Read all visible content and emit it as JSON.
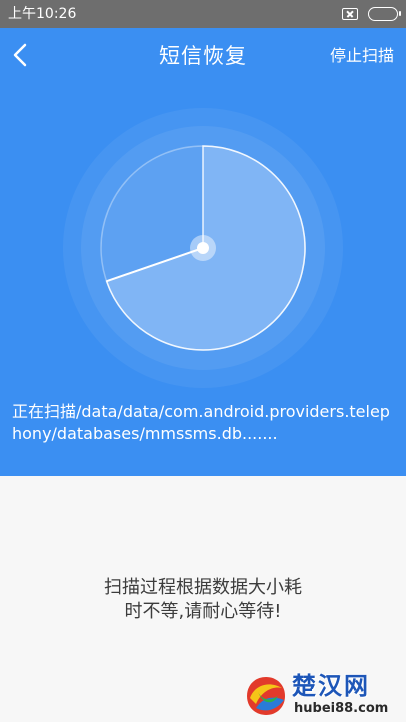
{
  "status_bar": {
    "time": "上午10:26"
  },
  "header": {
    "title": "短信恢复",
    "stop_label": "停止扫描"
  },
  "scan": {
    "path_text": "正在扫描/data/data/com.android.providers.telephony/databases/mmssms.db......."
  },
  "message": {
    "line1": "扫描过程根据数据大小耗",
    "line2": "时不等,请耐心等待!"
  },
  "watermark": {
    "name": "楚汉网",
    "url": "hubei88.com"
  },
  "icons": {
    "back": "chevron-left-icon",
    "sim": "no-sim-icon",
    "battery": "battery-icon",
    "radar": "radar-icon"
  },
  "colors": {
    "primary": "#3b8ff2",
    "status_bar": "#6e6e6e",
    "background": "#f7f7f7"
  }
}
